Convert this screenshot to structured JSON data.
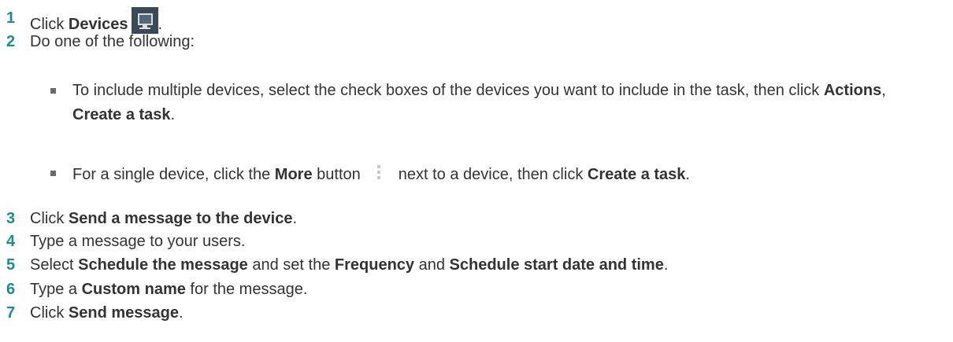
{
  "steps": [
    {
      "num": "1",
      "a": "Click ",
      "b": "Devices",
      "c": "."
    },
    {
      "num": "2",
      "a": "Do one of the following:"
    },
    {
      "num": "3",
      "a": "Click ",
      "b": "Send a message to the device",
      "c": "."
    },
    {
      "num": "4",
      "a": "Type a message to your users."
    },
    {
      "num": "5",
      "a": "Select ",
      "b": "Schedule the message",
      "c": " and set the ",
      "d": "Frequency",
      "e": " and ",
      "f": "Schedule start date and time",
      "g": "."
    },
    {
      "num": "6",
      "a": "Type a ",
      "b": "Custom name",
      "c": " for the message."
    },
    {
      "num": "7",
      "a": "Click ",
      "b": "Send message",
      "c": "."
    }
  ],
  "substeps": [
    {
      "a": "To include multiple devices, select the check boxes of the devices you want to include in the task, then click ",
      "b": "Actions",
      "c": ", ",
      "d": "Create a task",
      "e": "."
    },
    {
      "a": "For a single device, click the ",
      "b": "More",
      "c": " button",
      "d": "next to a device, then click ",
      "e": "Create a task",
      "f": "."
    }
  ],
  "icons": {
    "devices": "monitor-icon",
    "more": "vertical-dots-icon"
  },
  "colors": {
    "step_number": "#1c8c8c",
    "icon_bg": "#3c4957"
  }
}
